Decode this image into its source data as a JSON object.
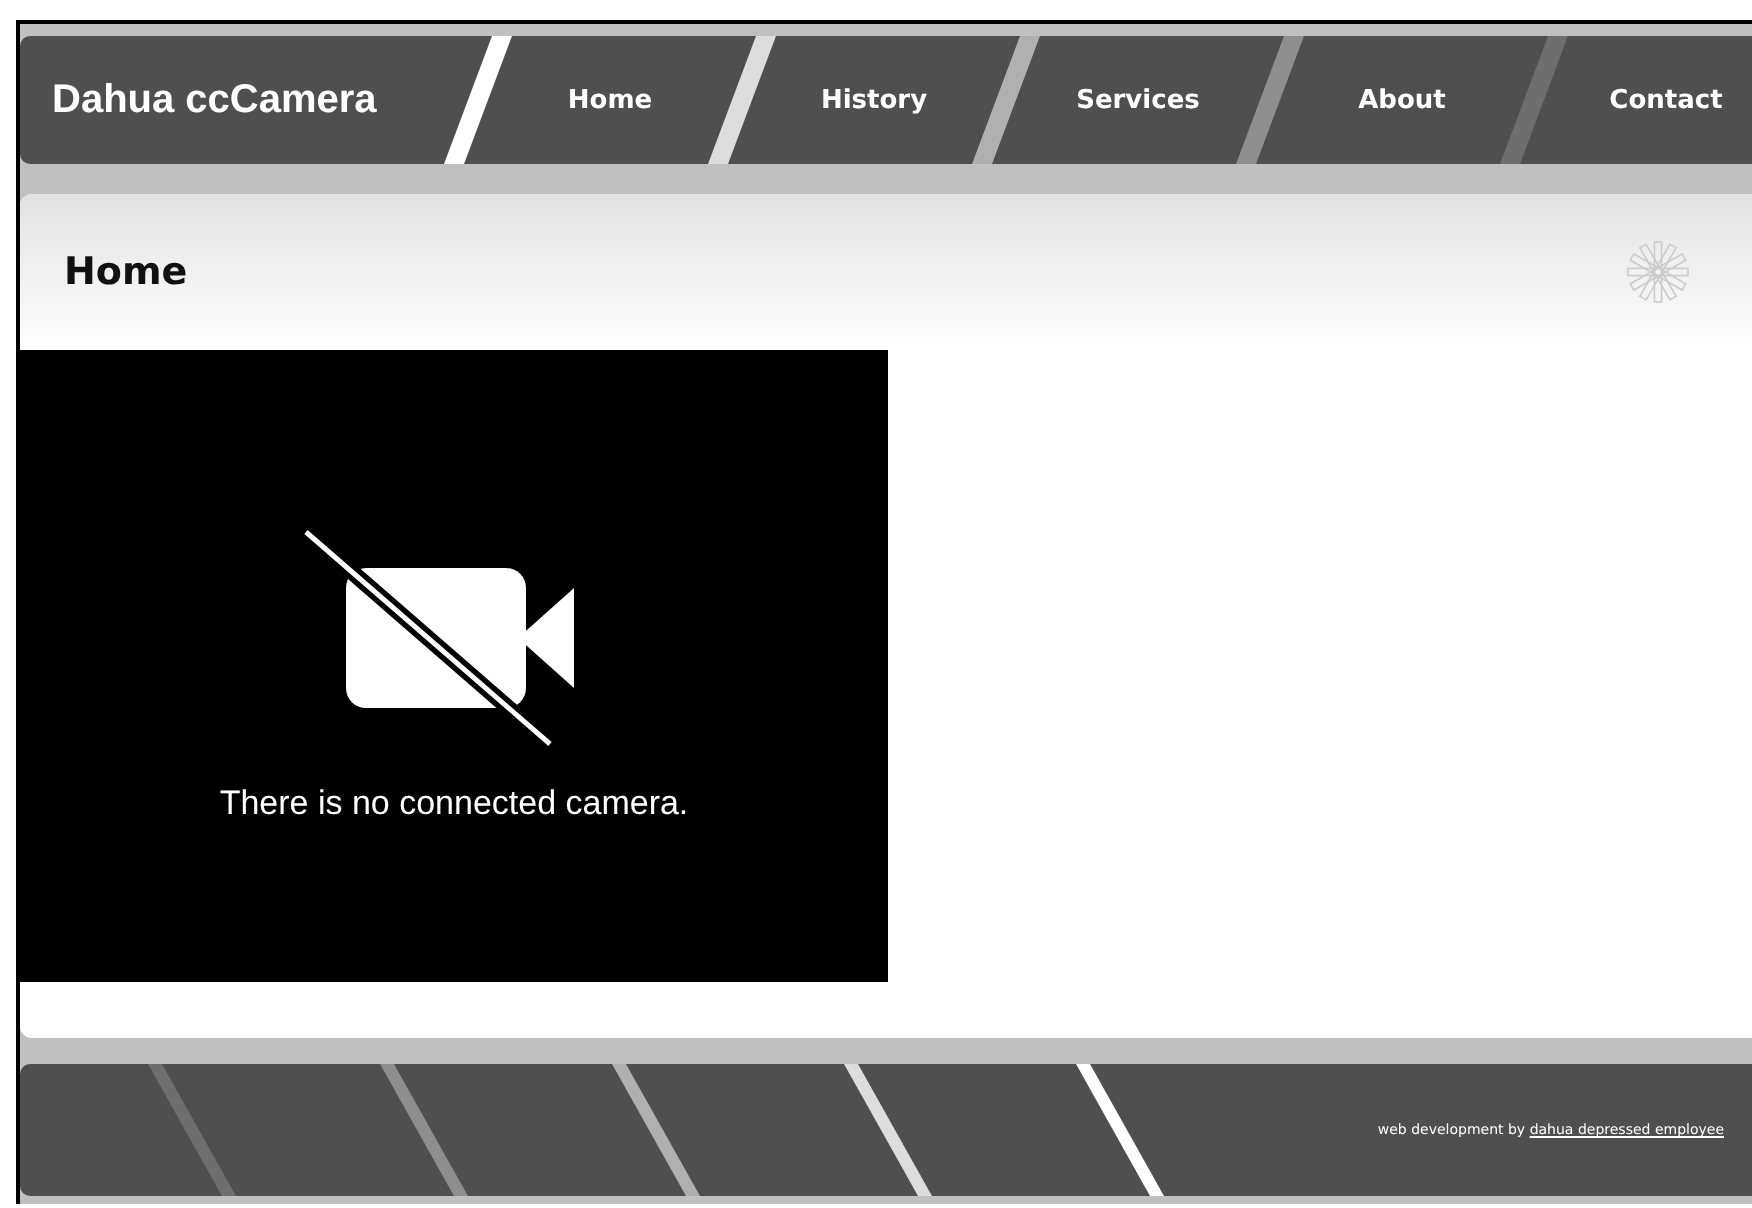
{
  "brand": "Dahua ccCamera",
  "nav": [
    {
      "label": "Home",
      "selected": false
    },
    {
      "label": "History",
      "selected": false
    },
    {
      "label": "Services",
      "selected": false
    },
    {
      "label": "About",
      "selected": false
    },
    {
      "label": "Contact",
      "selected": false
    }
  ],
  "page_title": "Home",
  "camera": {
    "message": "There is no connected camera."
  },
  "footer": {
    "text": "web development by",
    "link": "dahua depressed employee"
  }
}
